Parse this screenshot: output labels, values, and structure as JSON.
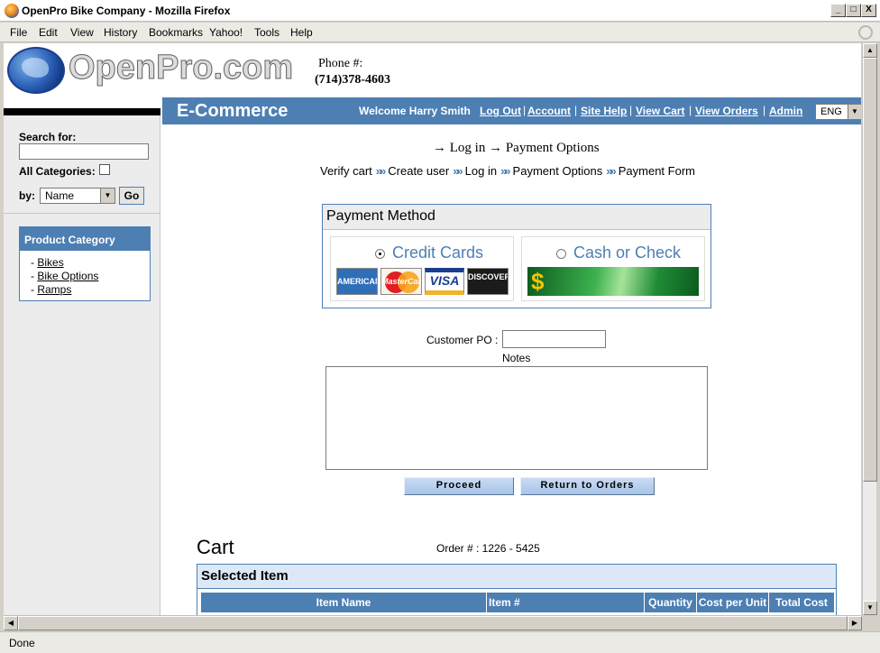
{
  "window": {
    "title": "OpenPro Bike Company - Mozilla Firefox",
    "minimize": "_",
    "maximize": "□",
    "close": "X"
  },
  "menu": [
    "File",
    "Edit",
    "View",
    "History",
    "Bookmarks",
    "Yahoo!",
    "Tools",
    "Help"
  ],
  "header": {
    "logo_text": "OpenPro.com",
    "phone_label": "Phone #:",
    "phone_number": "(714)378-4603"
  },
  "nav": {
    "brand": "E-Commerce",
    "welcome": "Welcome Harry Smith",
    "links": [
      "Log Out",
      "Account",
      "Site Help",
      "View Cart",
      "View Orders",
      "Admin"
    ],
    "language": "ENG"
  },
  "sidebar": {
    "search_label": "Search for:",
    "search_value": "",
    "all_categories_label": "All Categories:",
    "by_label": "by:",
    "by_value": "Name",
    "go_label": "Go",
    "category_title": "Product Category",
    "categories": [
      "Bikes",
      "Bike Options",
      "Ramps"
    ]
  },
  "steps": {
    "breadcrumb": "→ Log in → Payment Options",
    "items": [
      "Verify cart",
      "Create user",
      "Log in",
      "Payment Options",
      "Payment Form"
    ]
  },
  "payment": {
    "title": "Payment Method",
    "option_credit": "Credit Cards",
    "option_cash": "Cash or Check",
    "cards": [
      "AMERICAN EXPRESS",
      "MasterCard",
      "VISA",
      "DISCOVER"
    ],
    "cash_image_text": "$",
    "selected": "credit"
  },
  "form": {
    "customer_po_label": "Customer PO :",
    "customer_po_value": "",
    "notes_label": "Notes",
    "notes_value": "",
    "proceed_label": "Proceed",
    "return_label": "Return to Orders"
  },
  "cart": {
    "title": "Cart",
    "order_number": "Order # : 1226 - 5425",
    "selected_title": "Selected Item",
    "columns": [
      "Item Name",
      "Item #",
      "Quantity",
      "Cost per Unit",
      "Total Cost"
    ]
  },
  "status": {
    "text": "Done"
  },
  "colors": {
    "accent_blue": "#4d7fb3",
    "link_blue": "#4d7fb3"
  }
}
